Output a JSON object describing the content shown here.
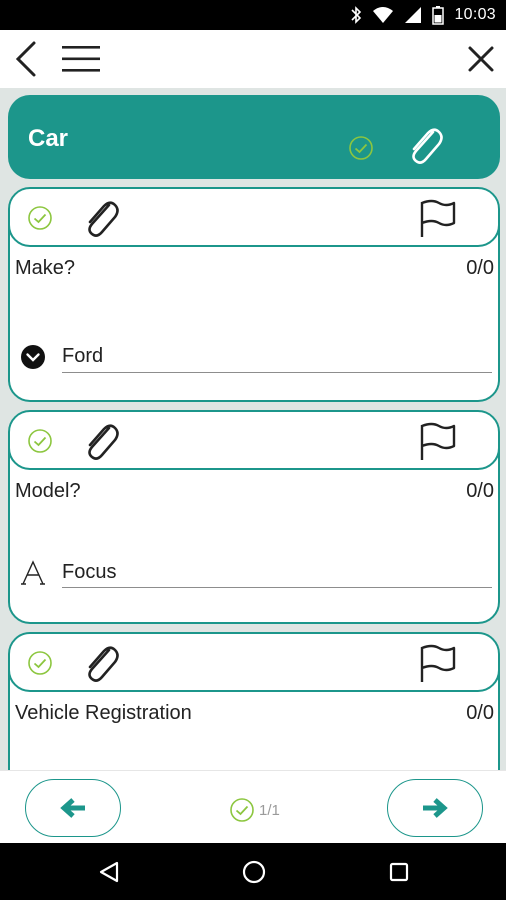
{
  "status_bar": {
    "time": "10:03"
  },
  "section": {
    "title": "Car"
  },
  "questions": [
    {
      "label": "Make?",
      "score": "0/0",
      "answer": "Ford",
      "answer_type": "dropdown"
    },
    {
      "label": "Model?",
      "score": "0/0",
      "answer": "Focus",
      "answer_type": "text"
    },
    {
      "label": "Vehicle Registration",
      "score": "0/0"
    }
  ],
  "footer": {
    "progress": "1/1"
  },
  "colors": {
    "accent": "#1c968b",
    "check": "#8cc63f",
    "background": "#dfe5e3"
  },
  "icons": {
    "back": "chevron-left-icon",
    "menu": "hamburger-menu-icon",
    "close": "close-icon",
    "check": "check-circle-icon",
    "attachment": "paperclip-icon",
    "flag": "flag-icon",
    "dropdown": "chevron-down-circle-icon",
    "text": "text-type-icon",
    "prev": "arrow-left-icon",
    "next": "arrow-right-icon"
  }
}
